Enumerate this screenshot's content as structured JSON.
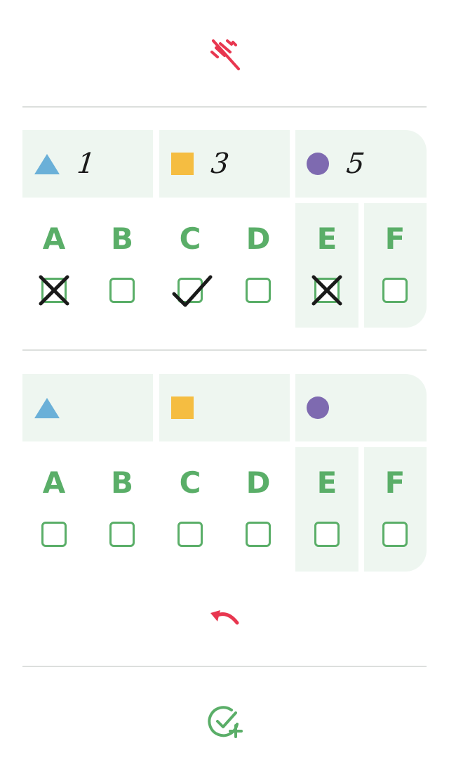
{
  "toolbar": {
    "top_icon": "no-signal-icon",
    "undo_icon": "undo-icon",
    "add_icon": "check-circle-plus-icon"
  },
  "colors": {
    "accent_red": "#e8364f",
    "green": "#5aae68",
    "panel_bg": "#eef6f0",
    "triangle": "#6ab0d8",
    "square": "#f5bd41",
    "circle": "#7e6ab0",
    "ink": "#1a1a1a"
  },
  "panels": [
    {
      "symbols": [
        {
          "shape": "triangle",
          "value": "1"
        },
        {
          "shape": "square",
          "value": "3"
        },
        {
          "shape": "circle",
          "value": "5"
        }
      ],
      "options": [
        {
          "letter": "A",
          "state": "crossed"
        },
        {
          "letter": "B",
          "state": "empty"
        },
        {
          "letter": "C",
          "state": "checked"
        },
        {
          "letter": "D",
          "state": "empty"
        },
        {
          "letter": "E",
          "state": "crossed"
        },
        {
          "letter": "F",
          "state": "empty"
        }
      ]
    },
    {
      "symbols": [
        {
          "shape": "triangle",
          "value": ""
        },
        {
          "shape": "square",
          "value": ""
        },
        {
          "shape": "circle",
          "value": ""
        }
      ],
      "options": [
        {
          "letter": "A",
          "state": "empty"
        },
        {
          "letter": "B",
          "state": "empty"
        },
        {
          "letter": "C",
          "state": "empty"
        },
        {
          "letter": "D",
          "state": "empty"
        },
        {
          "letter": "E",
          "state": "empty"
        },
        {
          "letter": "F",
          "state": "empty"
        }
      ]
    }
  ]
}
